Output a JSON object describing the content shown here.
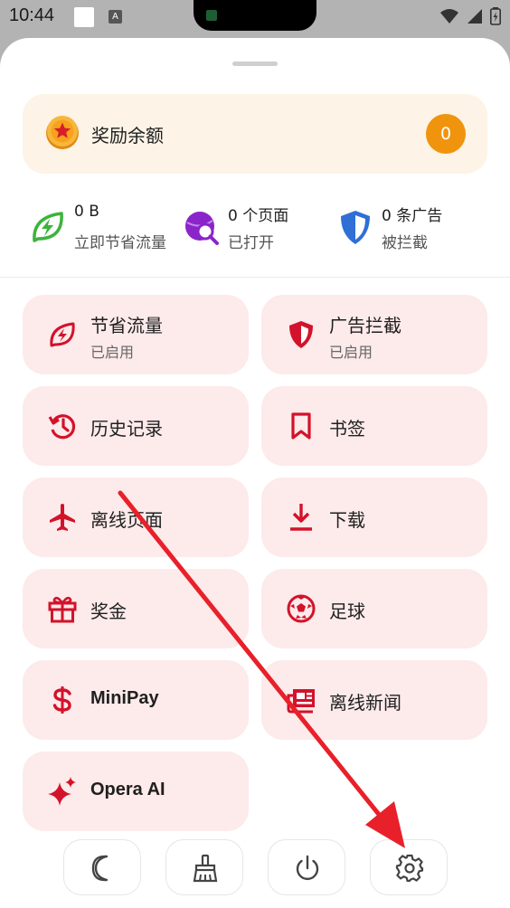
{
  "status_bar": {
    "time": "10:44",
    "icons": [
      "notification-square-icon",
      "a-icon",
      "wifi-icon",
      "signal-icon",
      "battery-icon"
    ]
  },
  "reward": {
    "label": "奖励余额",
    "balance": "0",
    "icon": "coin-star-icon",
    "colors": {
      "card_bg": "#fdf3e6",
      "badge": "#f0940d"
    }
  },
  "stats": [
    {
      "value": "0 B",
      "label": "立即节省流量",
      "icon": "leaf-bolt-icon",
      "color": "#3db33d"
    },
    {
      "value": "0 个页面",
      "label": "已打开",
      "icon": "globe-search-icon",
      "color": "#8b24c9"
    },
    {
      "value": "0 条广告",
      "label": "被拦截",
      "icon": "shield-icon",
      "color": "#2f6fd6"
    }
  ],
  "menu": {
    "data_saving": {
      "title": "节省流量",
      "subtitle": "已启用",
      "icon": "data-saving-icon"
    },
    "ad_block": {
      "title": "广告拦截",
      "subtitle": "已启用",
      "icon": "ad-block-shield-icon"
    },
    "history": {
      "title": "历史记录",
      "icon": "history-icon"
    },
    "bookmarks": {
      "title": "书签",
      "icon": "bookmark-icon"
    },
    "offline_pages": {
      "title": "离线页面",
      "icon": "airplane-icon"
    },
    "downloads": {
      "title": "下载",
      "icon": "download-icon"
    },
    "rewards": {
      "title": "奖金",
      "icon": "gift-icon"
    },
    "football": {
      "title": "足球",
      "icon": "football-icon"
    },
    "minipay": {
      "title": "MiniPay",
      "icon": "dollar-icon"
    },
    "offline_news": {
      "title": "离线新闻",
      "icon": "news-icon"
    },
    "opera_ai": {
      "title": "Opera AI",
      "icon": "sparkle-icon"
    }
  },
  "bottom_bar": [
    {
      "name": "night-mode",
      "icon": "moon-icon"
    },
    {
      "name": "clear-data",
      "icon": "broom-icon"
    },
    {
      "name": "exit",
      "icon": "power-icon"
    },
    {
      "name": "settings",
      "icon": "gear-icon"
    }
  ],
  "colors": {
    "accent": "#d3122b",
    "tile_bg": "#fdeaea",
    "annotation_arrow": "#e8202a"
  }
}
